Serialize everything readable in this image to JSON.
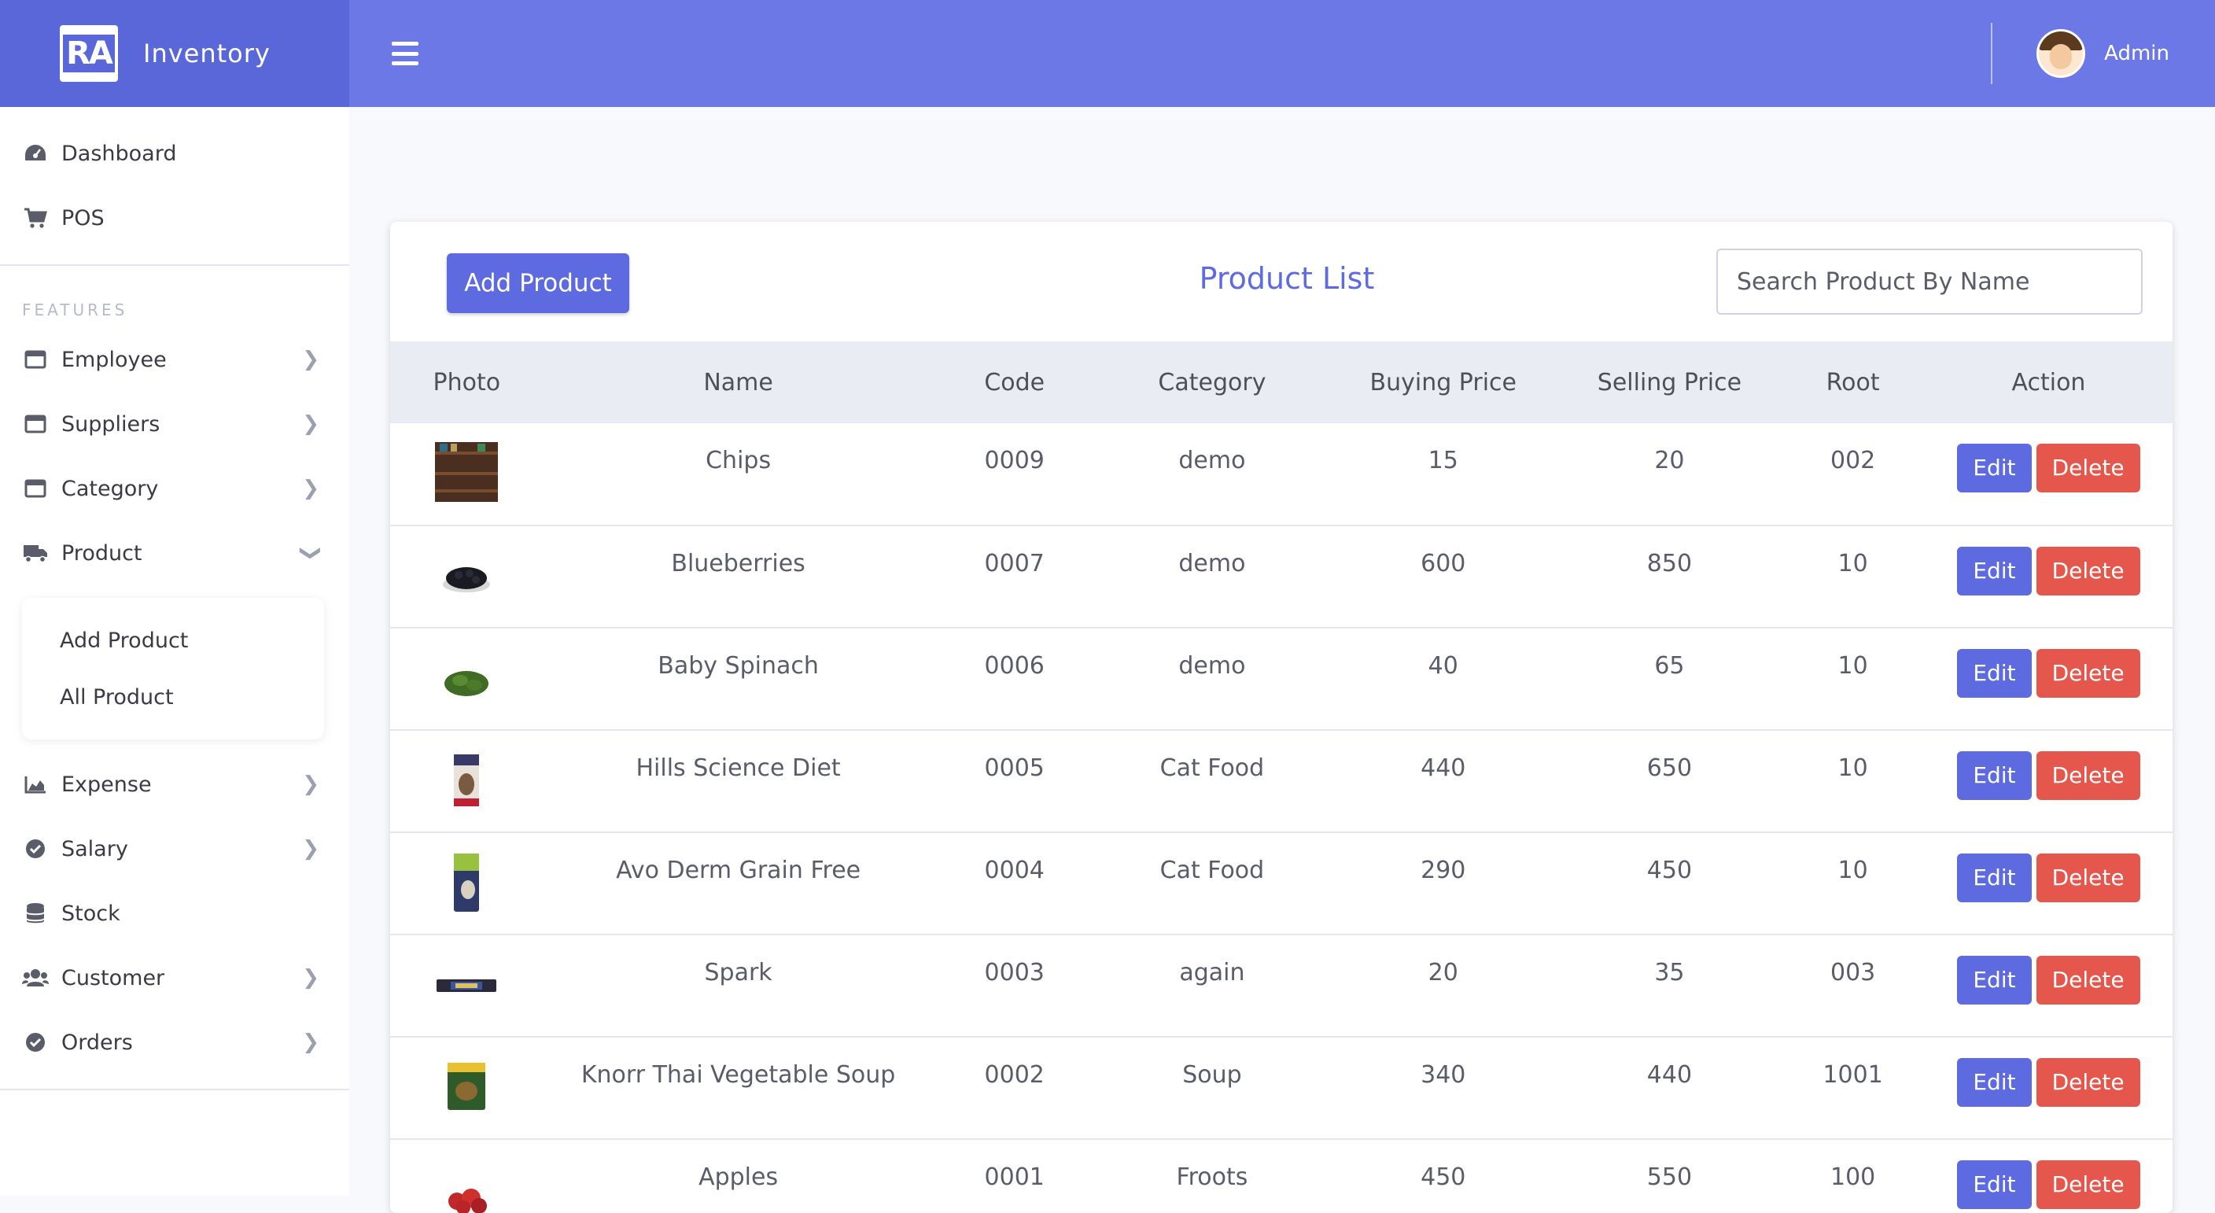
{
  "brand": {
    "logo_text": "RA",
    "name": "Inventory"
  },
  "topbar": {
    "user_name": "Admin"
  },
  "sidebar": {
    "top_items": [
      {
        "label": "Dashboard",
        "icon": "dashboard-icon"
      },
      {
        "label": "POS",
        "icon": "cart-icon"
      }
    ],
    "section_heading": "FEATURES",
    "items": [
      {
        "label": "Employee",
        "icon": "window-icon"
      },
      {
        "label": "Suppliers",
        "icon": "window-icon"
      },
      {
        "label": "Category",
        "icon": "window-icon"
      },
      {
        "label": "Product",
        "icon": "truck-icon"
      }
    ],
    "product_submenu": [
      {
        "label": "Add Product"
      },
      {
        "label": "All Product"
      }
    ],
    "items_after": [
      {
        "label": "Expense",
        "icon": "chart-area-icon"
      },
      {
        "label": "Salary",
        "icon": "check-circle-icon"
      },
      {
        "label": "Stock",
        "icon": "database-icon"
      },
      {
        "label": "Customer",
        "icon": "users-icon"
      },
      {
        "label": "Orders",
        "icon": "check-circle-icon"
      }
    ]
  },
  "card": {
    "add_button": "Add Product",
    "title": "Product List",
    "search_placeholder": "Search Product By Name"
  },
  "table": {
    "columns": [
      "Photo",
      "Name",
      "Code",
      "Category",
      "Buying Price",
      "Selling Price",
      "Root",
      "Action"
    ],
    "edit_label": "Edit",
    "delete_label": "Delete",
    "rows": [
      {
        "name": "Chips",
        "code": "0009",
        "category": "demo",
        "buying": "15",
        "selling": "20",
        "root": "002"
      },
      {
        "name": "Blueberries",
        "code": "0007",
        "category": "demo",
        "buying": "600",
        "selling": "850",
        "root": "10"
      },
      {
        "name": "Baby Spinach",
        "code": "0006",
        "category": "demo",
        "buying": "40",
        "selling": "65",
        "root": "10"
      },
      {
        "name": "Hills Science Diet",
        "code": "0005",
        "category": "Cat Food",
        "buying": "440",
        "selling": "650",
        "root": "10"
      },
      {
        "name": "Avo Derm Grain Free",
        "code": "0004",
        "category": "Cat Food",
        "buying": "290",
        "selling": "450",
        "root": "10"
      },
      {
        "name": "Spark",
        "code": "0003",
        "category": "again",
        "buying": "20",
        "selling": "35",
        "root": "003"
      },
      {
        "name": "Knorr Thai Vegetable Soup",
        "code": "0002",
        "category": "Soup",
        "buying": "340",
        "selling": "440",
        "root": "1001"
      },
      {
        "name": "Apples",
        "code": "0001",
        "category": "Froots",
        "buying": "450",
        "selling": "550",
        "root": "100"
      }
    ]
  },
  "colors": {
    "primary": "#5e6ae0",
    "topbar": "#6b78e5",
    "danger": "#e5574d"
  }
}
